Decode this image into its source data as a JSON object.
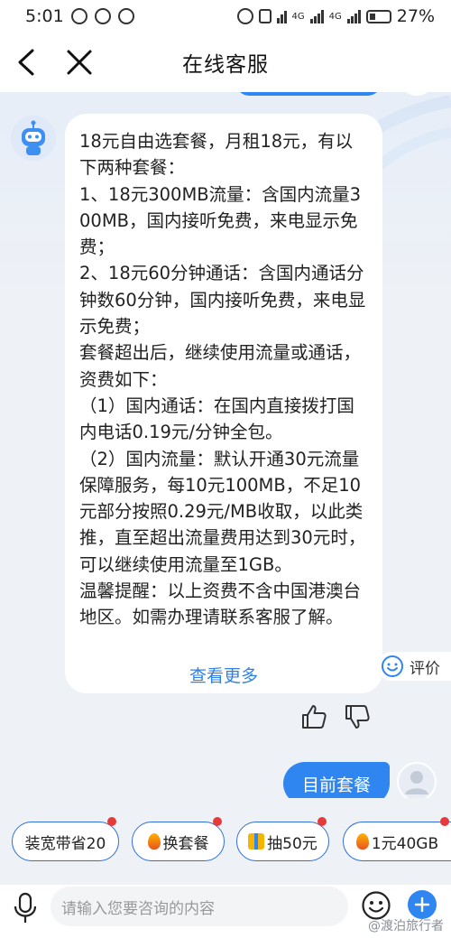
{
  "status_bar": {
    "time": "5:01",
    "battery": "27%",
    "network_a": "4G",
    "network_b": "4G"
  },
  "header": {
    "title": "在线客服"
  },
  "bot_message": {
    "text": "18元自由选套餐，月租18元，有以下两种套餐：\n1、18元300MB流量：含国内流量300MB，国内接听免费，来电显示免费；\n2、18元60分钟通话：含国内通话分钟数60分钟，国内接听免费，来电显示免费；\n套餐超出后，继续使用流量或通话，资费如下：\n（1）国内通话：在国内直接拨打国内电话0.19元/分钟全包。\n（2）国内流量：默认开通30元流量保障服务，每10元100MB，不足10元部分按照0.29元/MB收取，以此类推，直至超出流量费用达到30元时，可以继续使用流量至1GB。\n温馨提醒：以上资费不含中国港澳台地区。如需办理请联系客服了解。",
    "see_more": "查看更多"
  },
  "rate": {
    "label": "评价"
  },
  "user_message": {
    "text": "目前套餐"
  },
  "quick_chips": [
    {
      "label": "装宽带省20",
      "icon": "none"
    },
    {
      "label": "换套餐",
      "icon": "fire-icon"
    },
    {
      "label": "抽50元",
      "icon": "gift-icon"
    },
    {
      "label": "1元40GB",
      "icon": "fire-icon"
    }
  ],
  "input": {
    "placeholder": "请输入您要咨询的内容"
  },
  "watermark": {
    "text": "@渡泊旅行者"
  },
  "colors": {
    "accent": "#2f86f0",
    "link": "#2f80e8",
    "badge": "#e63a3a"
  }
}
